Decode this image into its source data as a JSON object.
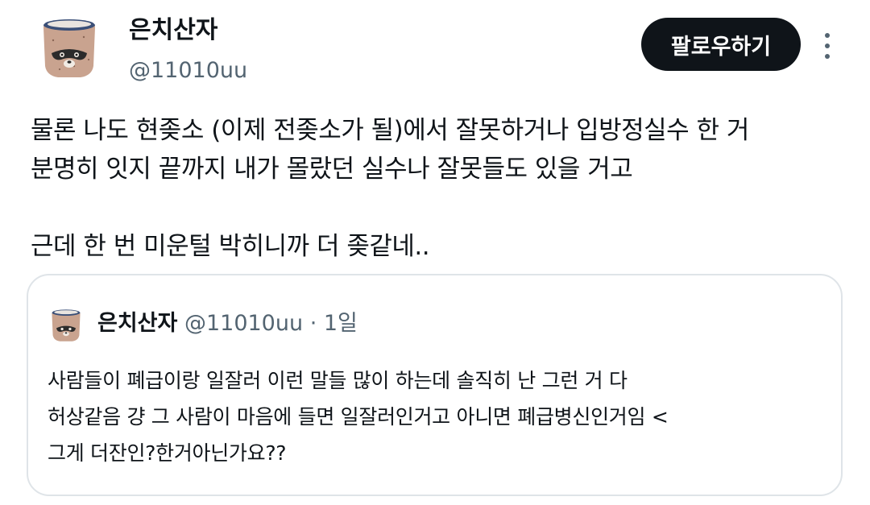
{
  "author": {
    "display_name": "은치산자",
    "handle": "@11010uu",
    "avatar_icon": "raccoon-cup-avatar-icon"
  },
  "actions": {
    "follow_label": "팔로우하기",
    "more_icon": "more-vertical-icon"
  },
  "tweet": {
    "lines": [
      "물론 나도 현좆소 (이제 전좆소가 될)에서 잘못하거나 입방정실수 한 거",
      "분명히 잇지 끝까지 내가 몰랐던 실수나 잘못들도 있을 거고",
      "",
      "근데 한 번 미운털 박히니까 더 좆같네.."
    ]
  },
  "quoted_tweet": {
    "display_name": "은치산자",
    "handle": "@11010uu",
    "separator": "·",
    "time": "1일",
    "lines": [
      "사람들이 폐급이랑 일잘러 이런 말들 많이 하는데 솔직히 난 그런 거 다",
      "허상같음 걍 그 사람이 마음에 들면 일잘러인거고 아니면 폐급병신인거임 <",
      "그게 더잔인?한거아닌가요??"
    ]
  },
  "colors": {
    "text_primary": "#0f1419",
    "text_secondary": "#536471",
    "button_bg": "#0f1419",
    "border": "#dfe4e8"
  }
}
